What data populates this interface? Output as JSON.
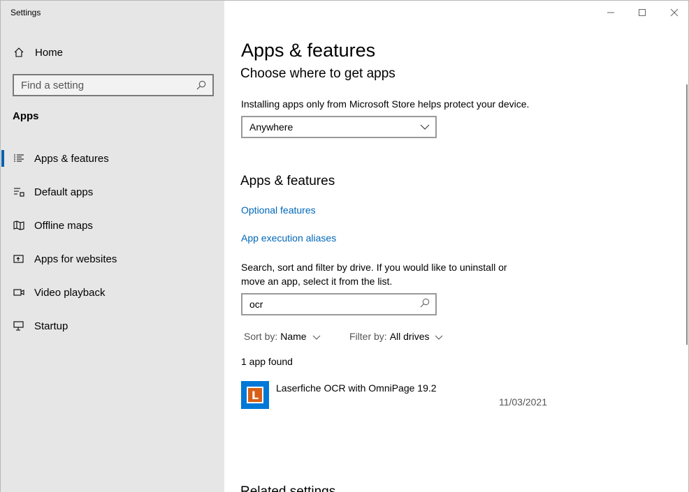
{
  "window": {
    "title": "Settings"
  },
  "caption_buttons": {
    "minimize": "—",
    "maximize": "☐",
    "close": "✕"
  },
  "sidebar": {
    "home_label": "Home",
    "search_placeholder": "Find a setting",
    "section_title": "Apps",
    "items": [
      {
        "label": "Apps & features",
        "icon": "apps-features-icon",
        "active": true
      },
      {
        "label": "Default apps",
        "icon": "default-apps-icon"
      },
      {
        "label": "Offline maps",
        "icon": "offline-maps-icon"
      },
      {
        "label": "Apps for websites",
        "icon": "apps-websites-icon"
      },
      {
        "label": "Video playback",
        "icon": "video-playback-icon"
      },
      {
        "label": "Startup",
        "icon": "startup-icon"
      }
    ]
  },
  "main": {
    "page_title": "Apps & features",
    "choose_heading": "Choose where to get apps",
    "choose_desc": "Installing apps only from Microsoft Store helps protect your device.",
    "source_dropdown": {
      "value": "Anywhere"
    },
    "apps_heading": "Apps & features",
    "optional_features_link": "Optional features",
    "aliases_link": "App execution aliases",
    "search_desc_line1": "Search, sort and filter by drive. If you would like to uninstall or",
    "search_desc_line2": "move an app, select it from the list.",
    "filter_value": "ocr",
    "sort": {
      "label": "Sort by:",
      "value": "Name"
    },
    "filter": {
      "label": "Filter by:",
      "value": "All drives"
    },
    "found_text": "1 app found",
    "apps": [
      {
        "name": "Laserfiche OCR with OmniPage 19.2",
        "date": "11/03/2021",
        "icon_letter": "L"
      }
    ],
    "related_heading": "Related settings"
  },
  "colors": {
    "accent": "#0063b1",
    "link": "#0067b8",
    "sidebar_bg": "#e6e6e6"
  }
}
